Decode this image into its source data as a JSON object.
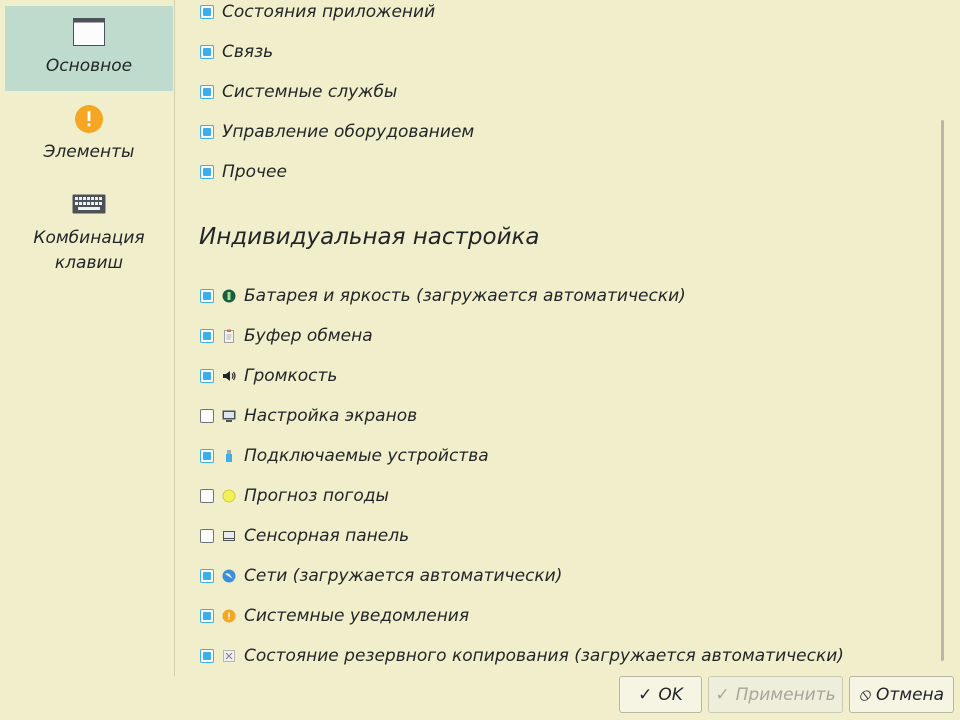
{
  "sidebar": {
    "items": [
      {
        "label": "Основное",
        "icon": "window-icon",
        "active": true
      },
      {
        "label": "Элементы",
        "icon": "warning-icon",
        "active": false
      },
      {
        "label_line1": "Комбинация",
        "label_line2": "клавиш",
        "icon": "keyboard-icon",
        "active": false
      }
    ]
  },
  "categories": [
    {
      "label": "Состояния приложений",
      "checked": true
    },
    {
      "label": "Связь",
      "checked": true
    },
    {
      "label": "Системные службы",
      "checked": true
    },
    {
      "label": "Управление оборудованием",
      "checked": true
    },
    {
      "label": "Прочее",
      "checked": true
    }
  ],
  "section_title": "Индивидуальная настройка",
  "plugins": [
    {
      "label": "Батарея и яркость (загружается автоматически)",
      "checked": true,
      "icon": "battery-icon"
    },
    {
      "label": "Буфер обмена",
      "checked": true,
      "icon": "clipboard-icon"
    },
    {
      "label": "Громкость",
      "checked": true,
      "icon": "speaker-icon"
    },
    {
      "label": "Настройка экранов",
      "checked": false,
      "icon": "display-icon"
    },
    {
      "label": "Подключаемые устройства",
      "checked": true,
      "icon": "usb-drive-icon"
    },
    {
      "label": "Прогноз погоды",
      "checked": false,
      "icon": "weather-sun-icon"
    },
    {
      "label": "Сенсорная панель",
      "checked": false,
      "icon": "touchpad-icon"
    },
    {
      "label": "Сети (загружается автоматически)",
      "checked": true,
      "icon": "network-globe-icon"
    },
    {
      "label": "Системные уведомления",
      "checked": true,
      "icon": "notification-icon"
    },
    {
      "label": "Состояние резервного копирования (загружается автоматически)",
      "checked": true,
      "icon": "backup-icon"
    }
  ],
  "buttons": {
    "ok": "OK",
    "apply": "Применить",
    "cancel": "Отмена"
  },
  "colors": {
    "background": "#f1efcb",
    "accent": "#3daee9",
    "sidebar_active": "#bedbcd"
  }
}
